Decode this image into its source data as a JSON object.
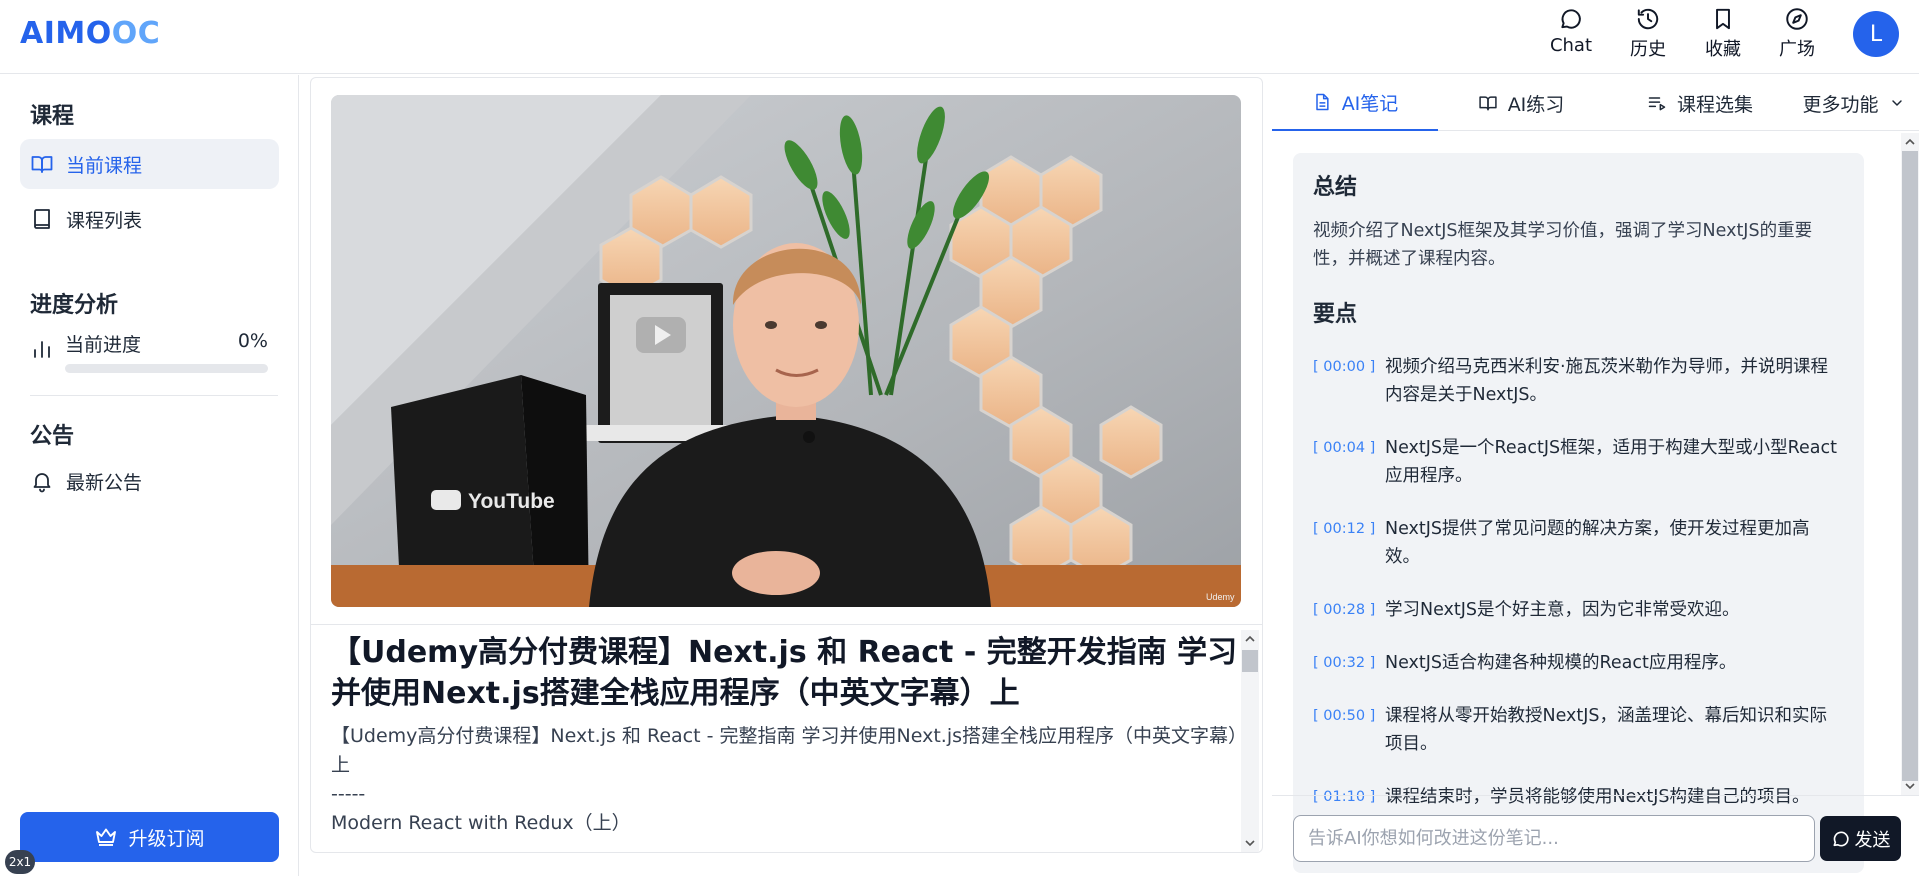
{
  "header": {
    "logo_part1": "AIMO",
    "logo_part2": "OC",
    "nav": [
      {
        "label": "Chat",
        "icon": "chat-bubble-icon"
      },
      {
        "label": "历史",
        "icon": "history-icon"
      },
      {
        "label": "收藏",
        "icon": "bookmark-icon"
      },
      {
        "label": "广场",
        "icon": "compass-icon"
      }
    ],
    "avatar_initial": "L"
  },
  "sidebar": {
    "course_section": "课程",
    "course_items": [
      {
        "label": "当前课程",
        "icon": "open-book-icon",
        "active": true
      },
      {
        "label": "课程列表",
        "icon": "book-icon",
        "active": false
      }
    ],
    "progress_section": "进度分析",
    "progress_label": "当前进度",
    "progress_value": "0%",
    "progress_fraction": 0,
    "notice_section": "公告",
    "notice_item": "最新公告",
    "upgrade_label": "升级订阅",
    "zoom_badge": "2x1"
  },
  "main": {
    "course_title": "【Udemy高分付费课程】Next.js 和 React - 完整开发指南 学习并使用Next.js搭建全栈应用程序（中英文字幕）上",
    "course_desc": "【Udemy高分付费课程】Next.js 和 React - 完整指南 学习并使用Next.js搭建全栈应用程序（中英文字幕）上",
    "desc_separator": "-----",
    "desc_extra": "Modern React with Redux（上）",
    "video_watermark": "Udemy"
  },
  "right": {
    "tabs": [
      {
        "label": "AI笔记",
        "icon": "document-icon",
        "active": true
      },
      {
        "label": "AI练习",
        "icon": "open-book-icon",
        "active": false
      },
      {
        "label": "课程选集",
        "icon": "playlist-icon",
        "active": false
      },
      {
        "label": "更多功能",
        "icon": "chevron-down-icon",
        "active": false
      }
    ],
    "summary_heading": "总结",
    "summary_text": "视频介绍了NextJS框架及其学习价值，强调了学习NextJS的重要性，并概述了课程内容。",
    "points_heading": "要点",
    "points": [
      {
        "time": "[ 00:00 ]",
        "text": "视频介绍马克西米利安·施瓦茨米勒作为导师，并说明课程内容是关于NextJS。"
      },
      {
        "time": "[ 00:04 ]",
        "text": "NextJS是一个ReactJS框架，适用于构建大型或小型React应用程序。"
      },
      {
        "time": "[ 00:12 ]",
        "text": "NextJS提供了常见问题的解决方案，使开发过程更加高效。"
      },
      {
        "time": "[ 00:28 ]",
        "text": "学习NextJS是个好主意，因为它非常受欢迎。"
      },
      {
        "time": "[ 00:32 ]",
        "text": "NextJS适合构建各种规模的React应用程序。"
      },
      {
        "time": "[ 00:50 ]",
        "text": "课程将从零开始教授NextJS，涵盖理论、幕后知识和实际项目。"
      },
      {
        "time": "[ 01:10 ]",
        "text": "课程结束时，学员将能够使用NextJS构建自己的项目。"
      }
    ],
    "input_placeholder": "告诉AI你想如何改进这份笔记...",
    "send_label": "发送"
  }
}
